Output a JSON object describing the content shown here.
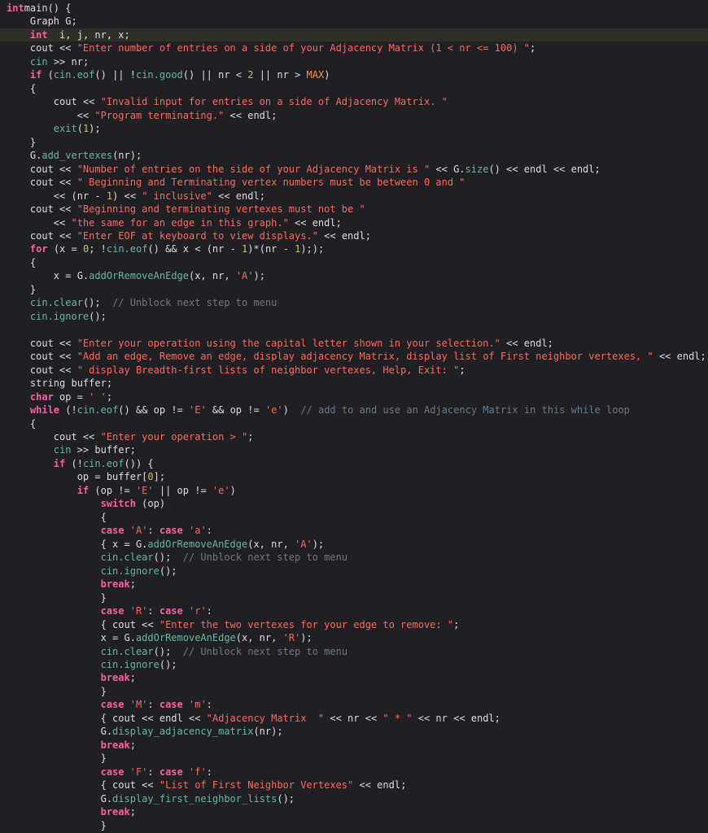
{
  "editor": {
    "language": "C++",
    "current_line": 3,
    "theme": {
      "background": "#1f1f24",
      "highlight_line": "#2f2f28",
      "keyword": "#fc5fa3",
      "function": "#67b7a4",
      "string": "#fc6a5d",
      "number": "#d0bf69",
      "comment": "#6c7986",
      "macro": "#fd8f3f",
      "plain": "#dfdfe0"
    },
    "lines": [
      [
        [
          "kw",
          "int"
        ],
        [
          "",
          "main() {"
        ]
      ],
      [
        [
          "",
          "    Graph G;"
        ]
      ],
      [
        [
          "",
          "    "
        ],
        [
          "kw",
          "int"
        ],
        [
          "",
          "  i, j, nr, x;"
        ]
      ],
      [
        [
          "",
          "    cout << "
        ],
        [
          "str",
          "\"Enter number of entries on a side of your Adjacency Matrix (1 < nr <= 100) \""
        ],
        [
          "",
          ";"
        ]
      ],
      [
        [
          "",
          "    "
        ],
        [
          "fn",
          "cin"
        ],
        [
          "",
          " >> nr;"
        ]
      ],
      [
        [
          "",
          "    "
        ],
        [
          "kw",
          "if"
        ],
        [
          "",
          " ("
        ],
        [
          "fn",
          "cin.eof"
        ],
        [
          "",
          "() || !"
        ],
        [
          "fn",
          "cin.good"
        ],
        [
          "",
          "() || nr < "
        ],
        [
          "num",
          "2"
        ],
        [
          "",
          " || nr > "
        ],
        [
          "mac",
          "MAX"
        ],
        [
          "",
          ")"
        ]
      ],
      [
        [
          "",
          "    {"
        ]
      ],
      [
        [
          "",
          "        cout << "
        ],
        [
          "str",
          "\"Invalid input for entries on a side of Adjacency Matrix. \""
        ]
      ],
      [
        [
          "",
          "            << "
        ],
        [
          "str",
          "\"Program terminating.\""
        ],
        [
          "",
          " << endl;"
        ]
      ],
      [
        [
          "",
          "        "
        ],
        [
          "fn",
          "exit"
        ],
        [
          "",
          "("
        ],
        [
          "num",
          "1"
        ],
        [
          "",
          ");"
        ]
      ],
      [
        [
          "",
          "    }"
        ]
      ],
      [
        [
          "",
          "    G."
        ],
        [
          "fn",
          "add_vertexes"
        ],
        [
          "",
          "(nr);"
        ]
      ],
      [
        [
          "",
          "    cout << "
        ],
        [
          "str",
          "\"Number of entries on the side of your Adjacency Matrix is \""
        ],
        [
          "",
          " << G."
        ],
        [
          "fn",
          "size"
        ],
        [
          "",
          "() << endl << endl;"
        ]
      ],
      [
        [
          "",
          "    cout << "
        ],
        [
          "str",
          "\" Beginning and Terminating vertex numbers must be between 0 and \""
        ]
      ],
      [
        [
          "",
          "        << (nr - "
        ],
        [
          "num",
          "1"
        ],
        [
          "",
          ") << "
        ],
        [
          "str",
          "\" inclusive\""
        ],
        [
          "",
          " << endl;"
        ]
      ],
      [
        [
          "",
          "    cout << "
        ],
        [
          "str",
          "\"Beginning and terminating vertexes must not be \""
        ]
      ],
      [
        [
          "",
          "        << "
        ],
        [
          "str",
          "\"the same for an edge in this graph.\""
        ],
        [
          "",
          " << endl;"
        ]
      ],
      [
        [
          "",
          "    cout << "
        ],
        [
          "str",
          "\"Enter EOF at keyboard to view displays.\""
        ],
        [
          "",
          " << endl;"
        ]
      ],
      [
        [
          "",
          "    "
        ],
        [
          "kw",
          "for"
        ],
        [
          "",
          " (x = "
        ],
        [
          "num",
          "0"
        ],
        [
          "",
          "; !"
        ],
        [
          "fn",
          "cin.eof"
        ],
        [
          "",
          "() && x < (nr - "
        ],
        [
          "num",
          "1"
        ],
        [
          "",
          ")*(nr - "
        ],
        [
          "num",
          "1"
        ],
        [
          "",
          "););"
        ]
      ],
      [
        [
          "",
          "    {"
        ]
      ],
      [
        [
          "",
          "        x = G."
        ],
        [
          "fn",
          "addOrRemoveAnEdge"
        ],
        [
          "",
          "(x, nr, "
        ],
        [
          "str",
          "'A'"
        ],
        [
          "",
          ");"
        ]
      ],
      [
        [
          "",
          "    }"
        ]
      ],
      [
        [
          "",
          "    "
        ],
        [
          "fn",
          "cin.clear"
        ],
        [
          "",
          "();  "
        ],
        [
          "cm",
          "// Unblock next step to menu"
        ]
      ],
      [
        [
          "",
          "    "
        ],
        [
          "fn",
          "cin.ignore"
        ],
        [
          "",
          "();"
        ]
      ],
      [
        [
          "",
          ""
        ]
      ],
      [
        [
          "",
          "    cout << "
        ],
        [
          "str",
          "\"Enter your operation using the capital letter shown in your selection.\""
        ],
        [
          "",
          " << endl;"
        ]
      ],
      [
        [
          "",
          "    cout << "
        ],
        [
          "str",
          "\"Add an edge, Remove an edge, display adjacency Matrix, display list of First neighbor vertexes, \""
        ],
        [
          "",
          " << endl;"
        ]
      ],
      [
        [
          "",
          "    cout << "
        ],
        [
          "str",
          "\" display Breadth-first lists of neighbor vertexes, Help, Exit: \""
        ],
        [
          "",
          ";"
        ]
      ],
      [
        [
          "",
          "    string buffer;"
        ]
      ],
      [
        [
          "",
          "    "
        ],
        [
          "kw",
          "char"
        ],
        [
          "",
          " op = "
        ],
        [
          "str",
          "' '"
        ],
        [
          "",
          ";"
        ]
      ],
      [
        [
          "",
          "    "
        ],
        [
          "kw",
          "while"
        ],
        [
          "",
          " (!"
        ],
        [
          "fn",
          "cin.eof"
        ],
        [
          "",
          "() && op != "
        ],
        [
          "str",
          "'E'"
        ],
        [
          "",
          " && op != "
        ],
        [
          "str",
          "'e'"
        ],
        [
          "",
          ")  "
        ],
        [
          "cm",
          "// add to and use an Adjacency Matrix in this while loop"
        ]
      ],
      [
        [
          "",
          "    {"
        ]
      ],
      [
        [
          "",
          "        cout << "
        ],
        [
          "str",
          "\"Enter your operation > \""
        ],
        [
          "",
          ";"
        ]
      ],
      [
        [
          "",
          "        "
        ],
        [
          "fn",
          "cin"
        ],
        [
          "",
          " >> buffer;"
        ]
      ],
      [
        [
          "",
          "        "
        ],
        [
          "kw",
          "if"
        ],
        [
          "",
          " (!"
        ],
        [
          "fn",
          "cin.eof"
        ],
        [
          "",
          "()) {"
        ]
      ],
      [
        [
          "",
          "            op = buffer["
        ],
        [
          "num",
          "0"
        ],
        [
          "",
          "];"
        ]
      ],
      [
        [
          "",
          "            "
        ],
        [
          "kw",
          "if"
        ],
        [
          "",
          " (op != "
        ],
        [
          "str",
          "'E'"
        ],
        [
          "",
          " || op != "
        ],
        [
          "str",
          "'e'"
        ],
        [
          "",
          ")"
        ]
      ],
      [
        [
          "",
          "                "
        ],
        [
          "kw",
          "switch"
        ],
        [
          "",
          " (op)"
        ]
      ],
      [
        [
          "",
          "                {"
        ]
      ],
      [
        [
          "",
          "                "
        ],
        [
          "kw",
          "case"
        ],
        [
          "",
          ""
        ],
        [
          "str",
          " 'A'"
        ],
        [
          "",
          ": "
        ],
        [
          "kw",
          "case"
        ],
        [
          "str",
          " 'a'"
        ],
        [
          "",
          ":"
        ]
      ],
      [
        [
          "",
          "                { x = G."
        ],
        [
          "fn",
          "addOrRemoveAnEdge"
        ],
        [
          "",
          "(x, nr, "
        ],
        [
          "str",
          "'A'"
        ],
        [
          "",
          ");"
        ]
      ],
      [
        [
          "",
          "                "
        ],
        [
          "fn",
          "cin.clear"
        ],
        [
          "",
          "();  "
        ],
        [
          "cm",
          "// Unblock next step to menu"
        ]
      ],
      [
        [
          "",
          "                "
        ],
        [
          "fn",
          "cin.ignore"
        ],
        [
          "",
          "();"
        ]
      ],
      [
        [
          "",
          "                "
        ],
        [
          "kw",
          "break"
        ],
        [
          "",
          ";"
        ]
      ],
      [
        [
          "",
          "                }"
        ]
      ],
      [
        [
          "",
          "                "
        ],
        [
          "kw",
          "case"
        ],
        [
          "str",
          " 'R'"
        ],
        [
          "",
          ": "
        ],
        [
          "kw",
          "case"
        ],
        [
          "str",
          " 'r'"
        ],
        [
          "",
          ":"
        ]
      ],
      [
        [
          "",
          "                { cout << "
        ],
        [
          "str",
          "\"Enter the two vertexes for your edge to remove: \""
        ],
        [
          "",
          ";"
        ]
      ],
      [
        [
          "",
          "                x = G."
        ],
        [
          "fn",
          "addOrRemoveAnEdge"
        ],
        [
          "",
          "(x, nr, "
        ],
        [
          "str",
          "'R'"
        ],
        [
          "",
          ");"
        ]
      ],
      [
        [
          "",
          "                "
        ],
        [
          "fn",
          "cin.clear"
        ],
        [
          "",
          "();  "
        ],
        [
          "cm",
          "// Unblock next step to menu"
        ]
      ],
      [
        [
          "",
          "                "
        ],
        [
          "fn",
          "cin.ignore"
        ],
        [
          "",
          "();"
        ]
      ],
      [
        [
          "",
          "                "
        ],
        [
          "kw",
          "break"
        ],
        [
          "",
          ";"
        ]
      ],
      [
        [
          "",
          "                }"
        ]
      ],
      [
        [
          "",
          "                "
        ],
        [
          "kw",
          "case"
        ],
        [
          "str",
          " 'M'"
        ],
        [
          "",
          ": "
        ],
        [
          "kw",
          "case"
        ],
        [
          "str",
          " 'm'"
        ],
        [
          "",
          ":"
        ]
      ],
      [
        [
          "",
          "                { cout << endl << "
        ],
        [
          "str",
          "\"Adjacency Matrix  \""
        ],
        [
          "",
          " << nr << "
        ],
        [
          "str",
          "\" * \""
        ],
        [
          "",
          " << nr << endl;"
        ]
      ],
      [
        [
          "",
          "                G."
        ],
        [
          "fn",
          "display_adjacency_matrix"
        ],
        [
          "",
          "(nr);"
        ]
      ],
      [
        [
          "",
          "                "
        ],
        [
          "kw",
          "break"
        ],
        [
          "",
          ";"
        ]
      ],
      [
        [
          "",
          "                }"
        ]
      ],
      [
        [
          "",
          "                "
        ],
        [
          "kw",
          "case"
        ],
        [
          "str",
          " 'F'"
        ],
        [
          "",
          ": "
        ],
        [
          "kw",
          "case"
        ],
        [
          "str",
          " 'f'"
        ],
        [
          "",
          ":"
        ]
      ],
      [
        [
          "",
          "                { cout << "
        ],
        [
          "str",
          "\"List of First Neighbor Vertexes\""
        ],
        [
          "",
          " << endl;"
        ]
      ],
      [
        [
          "",
          "                G."
        ],
        [
          "fn",
          "display_first_neighbor_lists"
        ],
        [
          "",
          "();"
        ]
      ],
      [
        [
          "",
          "                "
        ],
        [
          "kw",
          "break"
        ],
        [
          "",
          ";"
        ]
      ],
      [
        [
          "",
          "                }"
        ]
      ]
    ]
  }
}
